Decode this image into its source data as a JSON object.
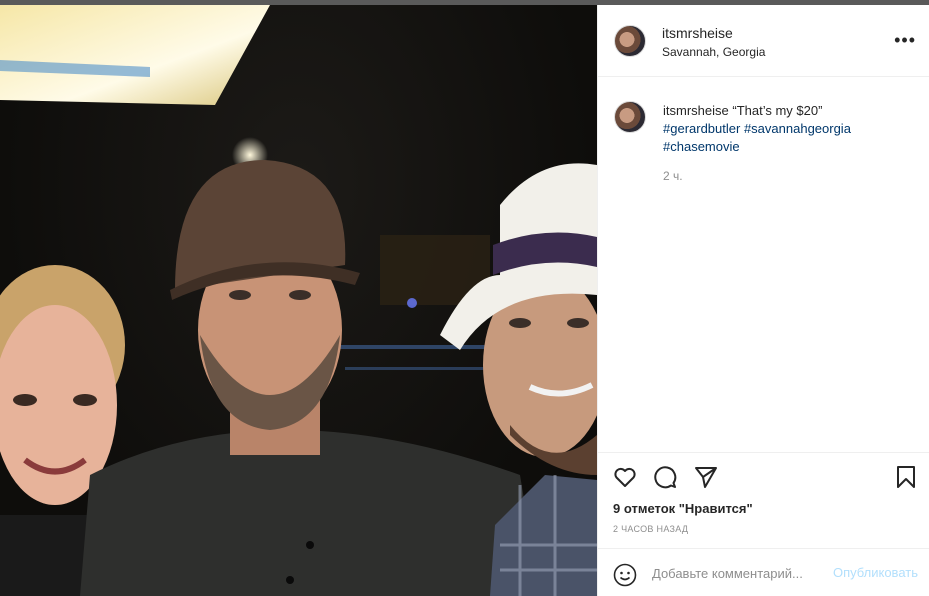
{
  "post": {
    "username": "itsmrsheise",
    "location": "Savannah, Georgia",
    "more_label": "•••"
  },
  "caption": {
    "username": "itsmrsheise",
    "text": "“That’s my $20”",
    "hashtags": [
      "#gerardbutler",
      "#savannahgeorgia",
      "#chasemovie"
    ],
    "time": "2 ч."
  },
  "actions": {
    "icons": [
      "heart-icon",
      "comment-icon",
      "share-icon",
      "bookmark-icon"
    ],
    "likes": "9 отметок \"Нравится\"",
    "time_ago": "2 ЧАСОВ НАЗАД"
  },
  "comment": {
    "placeholder": "Добавьте комментарий...",
    "post_label": "Опубликовать"
  },
  "colors": {
    "link": "#00376b",
    "muted": "#8e8e8e",
    "post_button_disabled": "#b2dffc",
    "border": "#efefef"
  }
}
